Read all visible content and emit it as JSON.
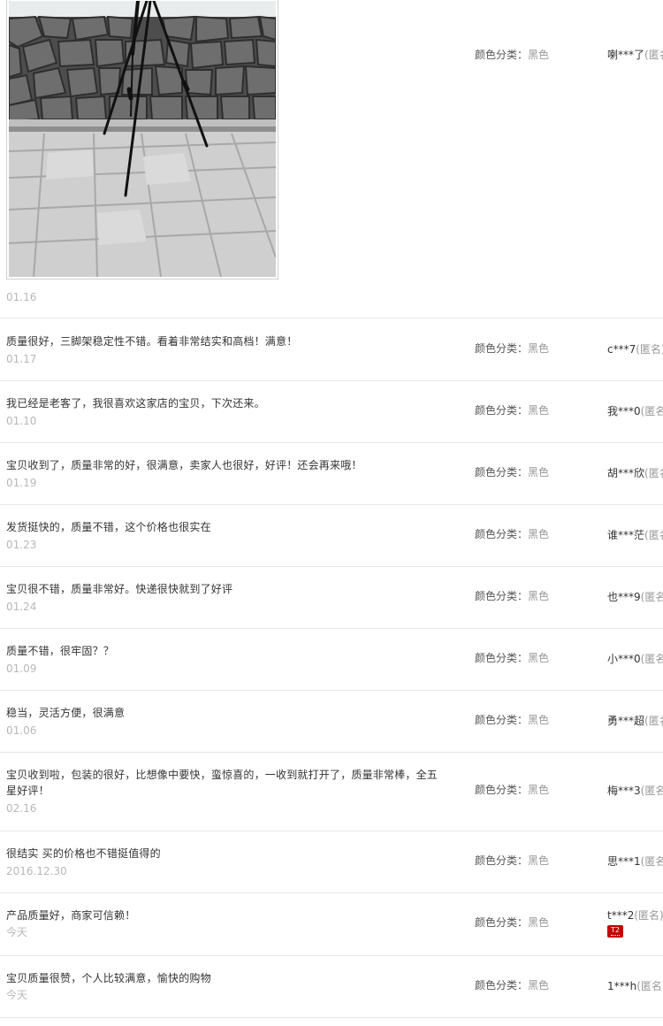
{
  "sku_label": "颜色分类",
  "sku_separator": "：",
  "first_review": {
    "date": "01.16",
    "sku_value": "黑色",
    "user_nick": "喇***了",
    "user_anon": "(匿名)"
  },
  "reviews": [
    {
      "text": "质量很好，三脚架稳定性不错。看着非常结实和高档！满意！",
      "date": "01.17",
      "sku_value": "黑色",
      "user_nick": "c***7",
      "user_anon": "(匿名)"
    },
    {
      "text": "我已经是老客了，我很喜欢这家店的宝贝，下次还来。",
      "date": "01.10",
      "sku_value": "黑色",
      "user_nick": "我***0",
      "user_anon": "(匿名)"
    },
    {
      "text": "宝贝收到了，质量非常的好，很满意，卖家人也很好，好评！还会再来哦！",
      "date": "01.19",
      "sku_value": "黑色",
      "user_nick": "胡***欣",
      "user_anon": "(匿名)"
    },
    {
      "text": "发货挺快的，质量不错，这个价格也很实在",
      "date": "01.23",
      "sku_value": "黑色",
      "user_nick": "谁***茫",
      "user_anon": "(匿名)"
    },
    {
      "text": "宝贝很不错，质量非常好。快递很快就到了好评",
      "date": "01.24",
      "sku_value": "黑色",
      "user_nick": "也***9",
      "user_anon": "(匿名)"
    },
    {
      "text": "质量不错，很牢固？？",
      "date": "01.09",
      "sku_value": "黑色",
      "user_nick": "小***0",
      "user_anon": "(匿名)"
    },
    {
      "text": "稳当，灵活方便，很满意",
      "date": "01.06",
      "sku_value": "黑色",
      "user_nick": "勇***超",
      "user_anon": "(匿名)"
    },
    {
      "text": "宝贝收到啦，包装的很好，比想像中要快，蛮惊喜的，一收到就打开了，质量非常棒，全五星好评！",
      "date": "02.16",
      "sku_value": "黑色",
      "user_nick": "梅***3",
      "user_anon": "(匿名)"
    },
    {
      "text": "很结实 买的价格也不错挺值得的",
      "date": "2016.12.30",
      "sku_value": "黑色",
      "user_nick": "思***1",
      "user_anon": "(匿名)"
    },
    {
      "text": "产品质量好，商家可信赖！",
      "date": "今天",
      "sku_value": "黑色",
      "user_nick": "t***2",
      "user_anon": "(匿名)",
      "badge": "T2"
    },
    {
      "text": "宝贝质量很赞，个人比较满意，愉快的购物",
      "date": "今天",
      "sku_value": "黑色",
      "user_nick": "1***h",
      "user_anon": "(匿名)"
    }
  ]
}
